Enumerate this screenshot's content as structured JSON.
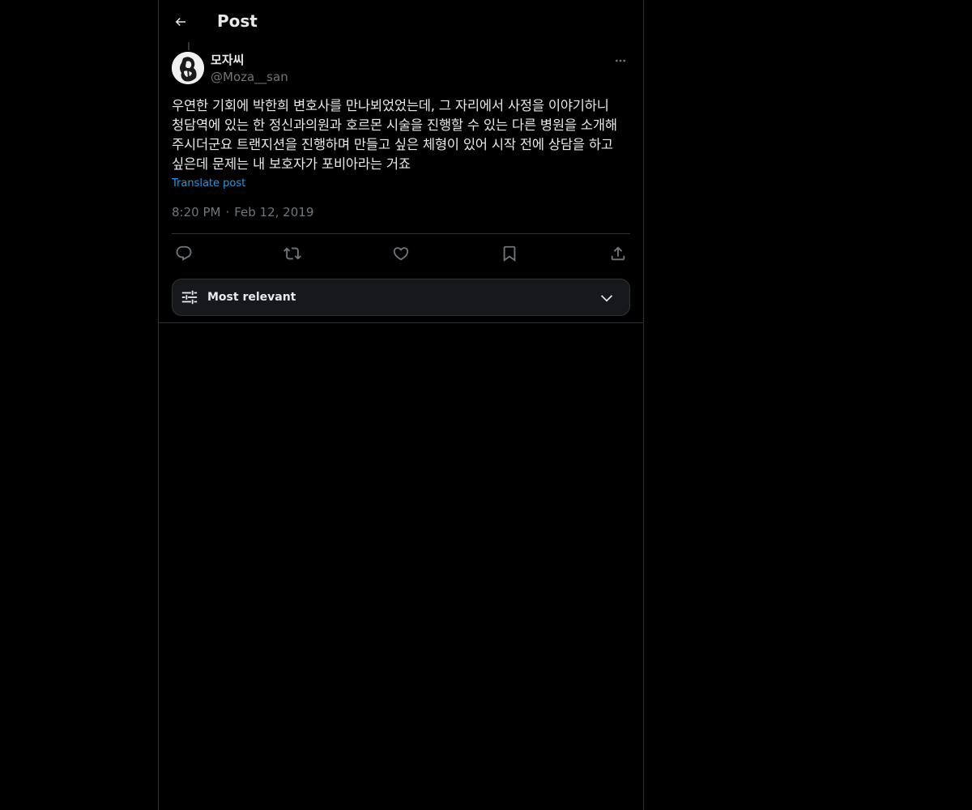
{
  "header": {
    "title": "Post",
    "back_icon": "arrow-left-icon"
  },
  "post": {
    "author": {
      "name": "모자씨",
      "handle": "@Moza__san",
      "avatar": "avatar-image"
    },
    "text_lines": [
      "우연한 기회에 박한희 변호사를 만나뵈었었는데, 그 자리에서 사정을 이야기하니",
      "청담역에 있는 한 정신과의원과 호르몬 시술을 진행할 수 있는 다른 병원을 소개해",
      "주시더군요 트랜지션을 진행하며 만들고 싶은 체형이 있어 시작 전에 상담을 하고",
      "싶은데 문제는 내 보호자가 포비아라는 거죠"
    ],
    "translate_label": "Translate post",
    "time": "8:20 PM",
    "separator": "·",
    "date": "Feb 12, 2019",
    "actions": [
      {
        "name": "reply",
        "icon": "reply-icon"
      },
      {
        "name": "repost",
        "icon": "repost-icon"
      },
      {
        "name": "like",
        "icon": "heart-icon"
      },
      {
        "name": "bookmark",
        "icon": "bookmark-icon"
      },
      {
        "name": "share",
        "icon": "share-icon"
      }
    ]
  },
  "sort": {
    "label": "Most relevant",
    "icon": "sliders-icon",
    "chevron": "chevron-down-icon"
  },
  "colors": {
    "background": "#000000",
    "text": "#e7e9ea",
    "secondary": "#71767b",
    "link": "#1d9bf0",
    "border": "#2f3336"
  }
}
